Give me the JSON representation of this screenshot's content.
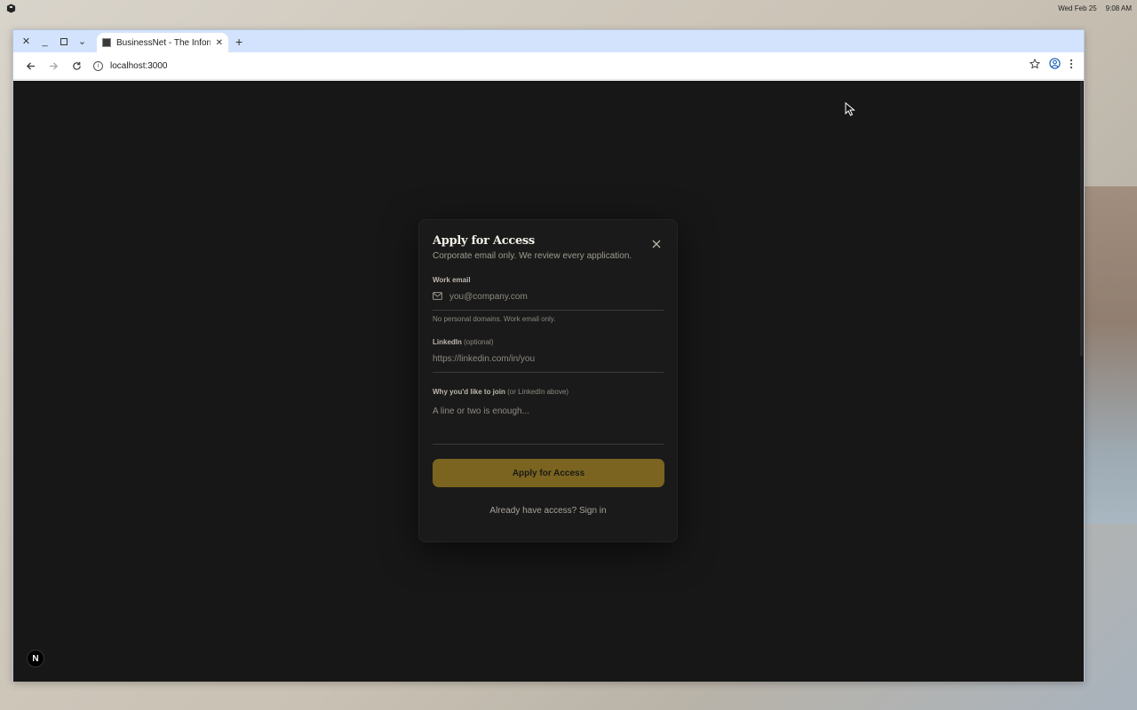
{
  "desktop": {
    "date": "Wed Feb 25",
    "time": "9:08 AM"
  },
  "browser": {
    "tab_title": "BusinessNet - The Informa",
    "url": "localhost:3000"
  },
  "modal": {
    "title": "Apply for Access",
    "subtitle": "Corporate email only. We review every application.",
    "email_label": "Work email",
    "email_placeholder": "you@company.com",
    "email_hint": "No personal domains. Work email only.",
    "linkedin_label": "LinkedIn",
    "linkedin_optional": "(optional)",
    "linkedin_placeholder": "https://linkedin.com/in/you",
    "reason_label": "Why you'd like to join",
    "reason_qualifier": "(or LinkedIn above)",
    "reason_placeholder": "A line or two is enough...",
    "apply_button": "Apply for Access",
    "signin_text": "Already have access? Sign in"
  },
  "devtools_badge": "N",
  "colors": {
    "accent": "#7a6420",
    "page_bg": "#171717",
    "modal_bg": "#1a1a1a"
  }
}
